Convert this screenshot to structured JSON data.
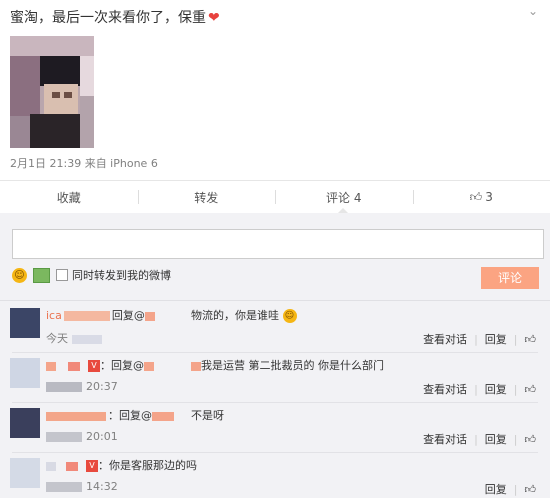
{
  "post": {
    "text": "蜜淘，最后一次来看你了，保重",
    "heart_icon": "heart-icon",
    "more_icon": "chevron-down-icon",
    "meta": "2月1日 21:39 来自 iPhone 6"
  },
  "actions": {
    "favorite": "收藏",
    "forward": "转发",
    "comment": "评论 4",
    "like_count": "3"
  },
  "composer": {
    "placeholder": "",
    "repost_label": "同时转发到我的微博",
    "submit_label": "评论"
  },
  "comments": [
    {
      "name": "ica",
      "reply_to": "回复@",
      "text": "物流的，你是谁哇",
      "time": "今天",
      "view_dialog": "查看对话",
      "reply_label": "回复"
    },
    {
      "name": "",
      "reply_to": "：回复@",
      "text": "我是运营 第二批裁员的 你是什么部门",
      "time": "20:37",
      "view_dialog": "查看对话",
      "reply_label": "回复"
    },
    {
      "name": "",
      "reply_to": "：回复@",
      "text": "不是呀",
      "time": "20:01",
      "view_dialog": "查看对话",
      "reply_label": "回复"
    },
    {
      "name": "",
      "reply_to": "：你是客服那边的吗",
      "text": "",
      "time": "14:32",
      "view_dialog": "",
      "reply_label": "回复"
    }
  ],
  "colors": {
    "accent": "#eb7350",
    "button": "#fba482",
    "background": "#f2f2f5"
  }
}
